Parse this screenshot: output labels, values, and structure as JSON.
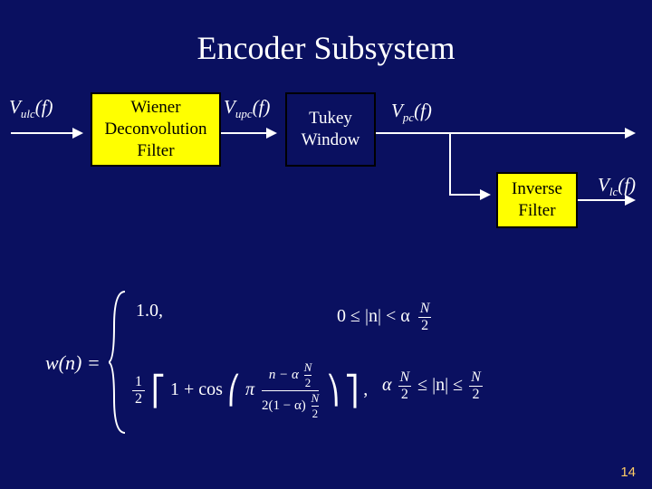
{
  "title": "Encoder Subsystem",
  "signals": {
    "vulc": {
      "base": "V",
      "sub": "ulc",
      "arg": "(f)"
    },
    "vupc": {
      "base": "V",
      "sub": "upc",
      "arg": "(f)"
    },
    "vpc": {
      "base": "V",
      "sub": "pc",
      "arg": "(f)"
    },
    "vlc": {
      "base": "V",
      "sub": "lc",
      "arg": "(f)"
    }
  },
  "blocks": {
    "wiener": {
      "line1": "Wiener",
      "line2": "Deconvolution",
      "line3": "Filter"
    },
    "tukey": {
      "line1": "Tukey",
      "line2": "Window"
    },
    "inverse": {
      "line1": "Inverse",
      "line2": "Filter"
    }
  },
  "equation": {
    "lhs": "w(n) =",
    "case1_val": "1.0,",
    "case1_cond_a": "0 ≤ |n| < α",
    "case1_cond_b": "N",
    "case1_cond_c": "2",
    "case2_val_a": "1",
    "case2_val_b": "2",
    "case2_val_c": "1 + cos",
    "case2_val_d": "π",
    "case2_val_e": "n − α",
    "case2_val_f": "N",
    "case2_val_g": "2",
    "case2_val_h": "2(1 − α)",
    "case2_val_i": "N",
    "case2_val_j": "2",
    "case2_comma": ",",
    "case2_cond_a": "α",
    "case2_cond_b": "N",
    "case2_cond_c": "2",
    "case2_cond_d": "≤ |n| ≤",
    "case2_cond_e": "N",
    "case2_cond_f": "2"
  },
  "page_number": "14"
}
